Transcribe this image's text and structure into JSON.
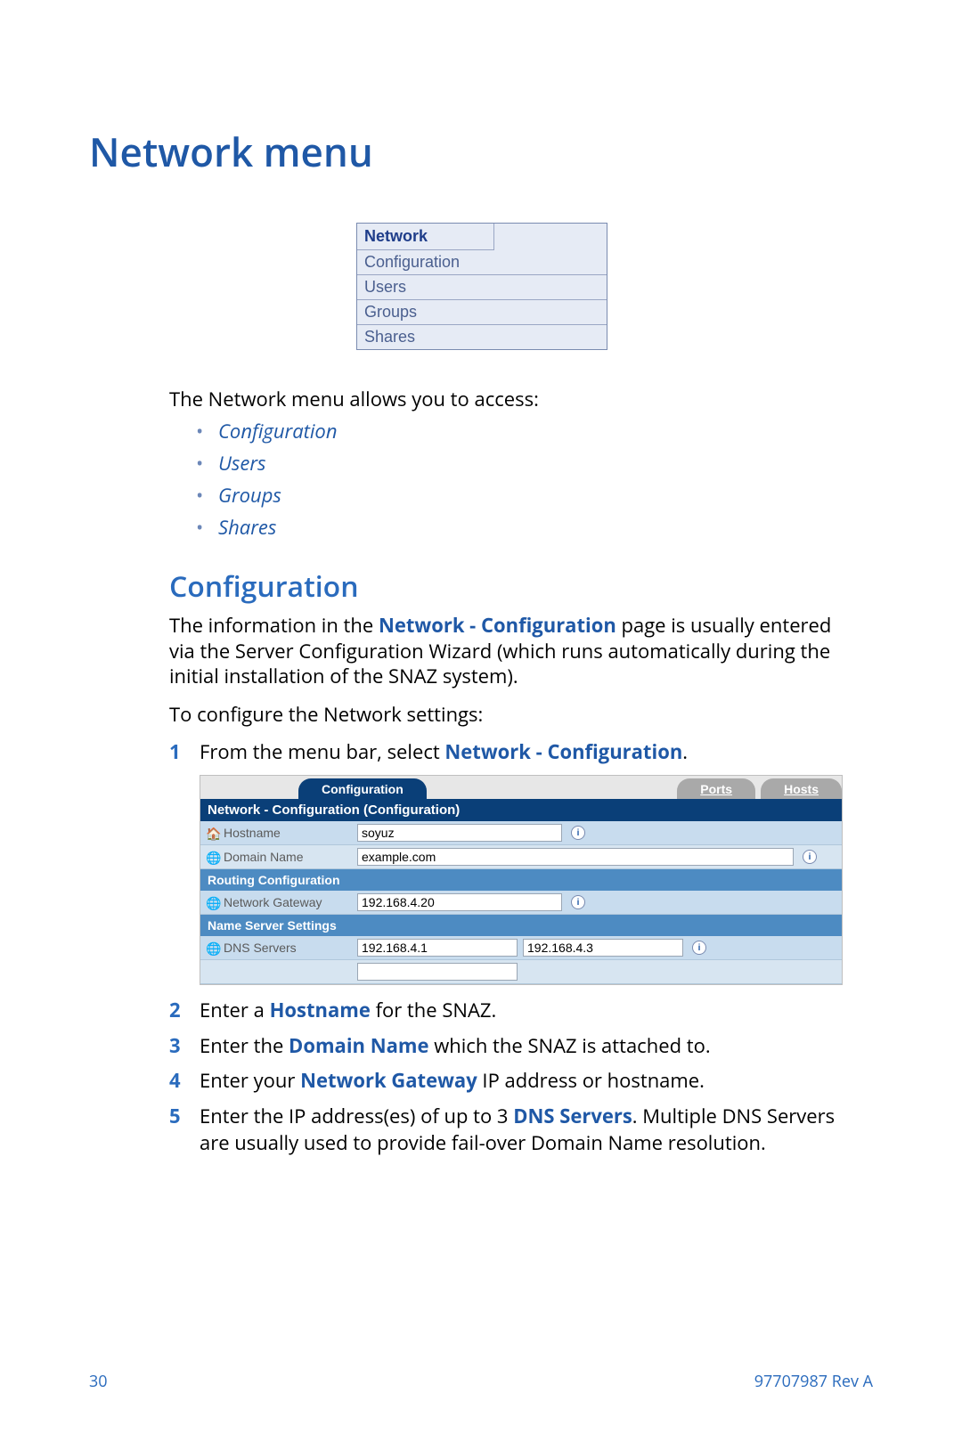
{
  "title": "Network menu",
  "menu_box": {
    "header": "Network",
    "items": [
      "Configuration",
      "Users",
      "Groups",
      "Shares"
    ]
  },
  "lead": "The Network menu allows you to access:",
  "link_list": [
    "Configuration",
    "Users",
    "Groups",
    "Shares"
  ],
  "section": {
    "heading": "Configuration",
    "para1_a": "The information in the ",
    "para1_b": "Network - Configuration",
    "para1_c": " page is usually entered via the Server Configuration Wizard (which runs automatically during the initial installation of the SNAZ system).",
    "para2": "To configure the Network settings:"
  },
  "steps": {
    "s1_a": "From the menu bar, select ",
    "s1_b": "Network - Configuration",
    "s1_c": ".",
    "s2_a": "Enter a ",
    "s2_b": "Hostname",
    "s2_c": " for the SNAZ.",
    "s3_a": "Enter the ",
    "s3_b": "Domain Name",
    "s3_c": " which the SNAZ is attached to.",
    "s4_a": "Enter your ",
    "s4_b": "Network Gateway",
    "s4_c": " IP address or hostname.",
    "s5_a": "Enter the IP address(es) of up to 3 ",
    "s5_b": "DNS Servers",
    "s5_c": ". Multiple DNS Servers are usually used to provide fail-over Domain Name resolution."
  },
  "panel": {
    "tabs": {
      "active": "Configuration",
      "t2": "Ports",
      "t3": "Hosts"
    },
    "titlebar": "Network - Configuration (Configuration)",
    "hostname_label": "Hostname",
    "hostname_value": "soyuz",
    "domain_label": "Domain Name",
    "domain_value": "example.com",
    "routing_header": "Routing Configuration",
    "gateway_label": "Network Gateway",
    "gateway_value": "192.168.4.20",
    "ns_header": "Name Server Settings",
    "dns_label": "DNS Servers",
    "dns1": "192.168.4.1",
    "dns2": "192.168.4.3",
    "dns3": ""
  },
  "footer": {
    "page": "30",
    "doc": "97707987 Rev A"
  }
}
